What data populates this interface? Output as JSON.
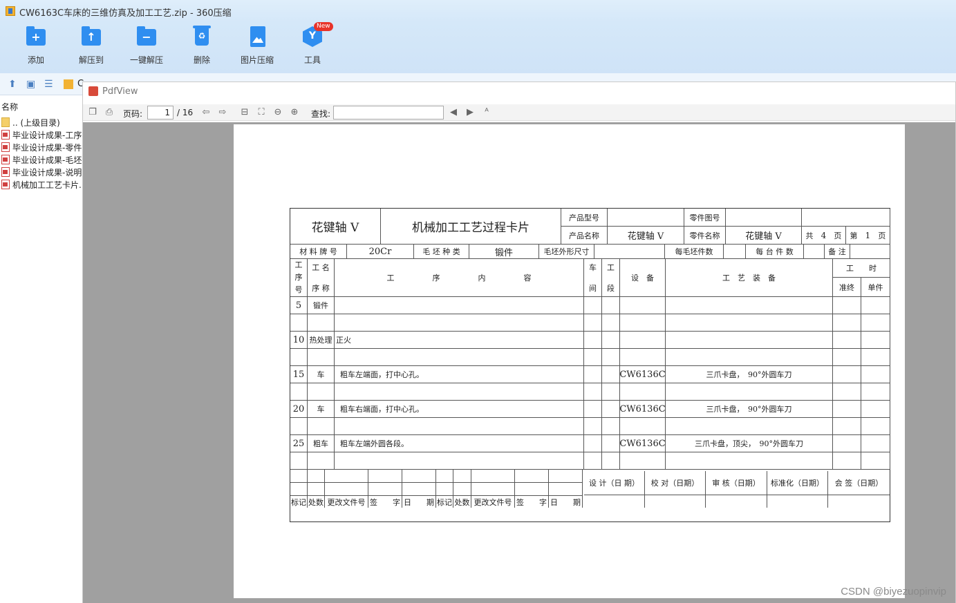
{
  "window": {
    "title": "CW6163C车床的三维仿真及加工工艺.zip - 360压缩"
  },
  "toolbar": {
    "add": "添加",
    "extract_to": "解压到",
    "one_click_extract": "一键解压",
    "delete": "删除",
    "image_compress": "图片压缩",
    "tools": "工具",
    "new_badge": "New"
  },
  "nav": {
    "path_prefix": "C"
  },
  "filelist": {
    "column_name": "名称",
    "items": [
      {
        "name": ".. (上级目录)",
        "type": "folder"
      },
      {
        "name": "毕业设计成果-工序",
        "type": "pdf"
      },
      {
        "name": "毕业设计成果-零件",
        "type": "pdf"
      },
      {
        "name": "毕业设计成果-毛坯",
        "type": "pdf"
      },
      {
        "name": "毕业设计成果-说明",
        "type": "pdf"
      },
      {
        "name": "机械加工工艺卡片.",
        "type": "pdf"
      }
    ]
  },
  "pdfview": {
    "title": "PdfView",
    "page_label": "页码:",
    "page_current": "1",
    "page_total": "/ 16",
    "find_label": "查找:"
  },
  "card": {
    "part_title": "花键轴 V",
    "card_title": "机械加工工艺过程卡片",
    "product_model_label": "产品型号",
    "product_model": "",
    "part_no_label": "零件图号",
    "part_no": "",
    "product_name_label": "产品名称",
    "product_name": "花键轴 V",
    "part_name_label": "零件名称",
    "part_name": "花键轴 V",
    "total_label": "共",
    "total_pages": "4",
    "page_unit": "页",
    "page_no_label": "第",
    "page_no": "1",
    "page_unit2": "页",
    "material_label": "材 料 牌 号",
    "material": "20Cr",
    "blank_type_label": "毛 坯 种 类",
    "blank_type": "锻件",
    "blank_size_label": "毛坯外形尺寸",
    "per_blank_label": "每毛坯件数",
    "per_unit_label": "每 台 件 数",
    "remark_label": "备 注",
    "hdr_seq": [
      "工",
      "序",
      "号"
    ],
    "hdr_name": [
      "工 名",
      "序 称"
    ],
    "hdr_content": "工　　　　　序　　　　　内　　　　　容",
    "hdr_workshop": [
      "车",
      "间"
    ],
    "hdr_section": [
      "工",
      "段"
    ],
    "hdr_equipment": "设　备",
    "hdr_tooling": "工　艺　装　备",
    "hdr_time": "工　　时",
    "hdr_time_prep": "准终",
    "hdr_time_unit": "单件",
    "rows": [
      {
        "seq": "5",
        "name": "锻件",
        "content": "",
        "equip": "",
        "tool": ""
      },
      {
        "seq": "",
        "name": "",
        "content": "",
        "equip": "",
        "tool": ""
      },
      {
        "seq": "10",
        "name": "热处理",
        "content": "正火",
        "equip": "",
        "tool": ""
      },
      {
        "seq": "",
        "name": "",
        "content": "",
        "equip": "",
        "tool": ""
      },
      {
        "seq": "15",
        "name": "车",
        "content": "粗车左端面，打中心孔。",
        "equip": "CW6136C",
        "tool": "三爪卡盘，　90°外圆车刀"
      },
      {
        "seq": "",
        "name": "",
        "content": "",
        "equip": "",
        "tool": ""
      },
      {
        "seq": "20",
        "name": "车",
        "content": "粗车右端面，打中心孔。",
        "equip": "CW6136C",
        "tool": "三爪卡盘，　90°外圆车刀"
      },
      {
        "seq": "",
        "name": "",
        "content": "",
        "equip": "",
        "tool": ""
      },
      {
        "seq": "25",
        "name": "粗车",
        "content": "粗车左端外圆各段。",
        "equip": "CW6136C",
        "tool": "三爪卡盘，顶尖，　90°外圆车刀"
      },
      {
        "seq": "",
        "name": "",
        "content": "",
        "equip": "",
        "tool": ""
      }
    ],
    "footer_sign": [
      "设 计（日 期）",
      "校 对（日期）",
      "审 核（日期）",
      "标准化（日期）",
      "会 签（日期）"
    ],
    "footer_rev": [
      "标记",
      "处数",
      "更改文件号",
      "签　　字",
      "日　　期",
      "标记",
      "处数",
      "更改文件号",
      "签　　字",
      "日　　期"
    ]
  },
  "watermark": "CSDN @biyezuopinvip"
}
